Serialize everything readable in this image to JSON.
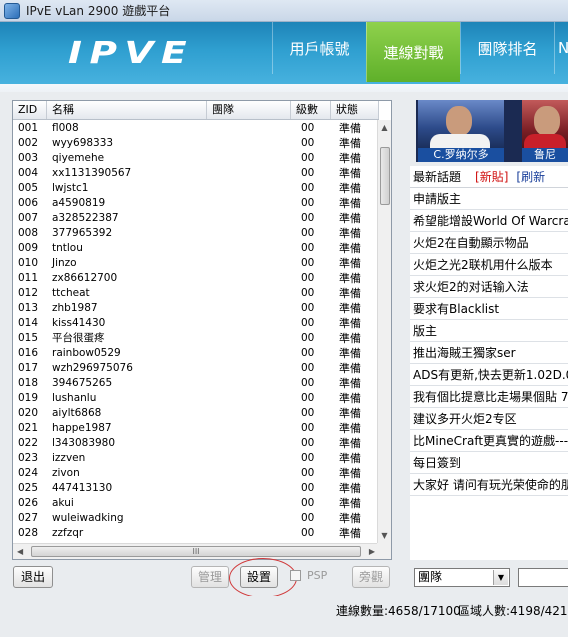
{
  "window": {
    "title": "IPvE vLan 2900 遊戲平台"
  },
  "header": {
    "logo_text": "IPVE",
    "nav_tabs": [
      {
        "label": "用戶帳號",
        "active": false
      },
      {
        "label": "連線對戰",
        "active": true
      },
      {
        "label": "團隊排名",
        "active": false
      },
      {
        "label": "N",
        "active": false
      }
    ]
  },
  "player_list": {
    "columns": [
      "ZID",
      "名稱",
      "團隊",
      "級數",
      "狀態"
    ],
    "rows": [
      {
        "zid": "001",
        "name": "fl008",
        "team": "",
        "level": "00",
        "status": "準備"
      },
      {
        "zid": "002",
        "name": "wyy698333",
        "team": "",
        "level": "00",
        "status": "準備"
      },
      {
        "zid": "003",
        "name": "qiyemehe",
        "team": "",
        "level": "00",
        "status": "準備"
      },
      {
        "zid": "004",
        "name": "xx1131390567",
        "team": "",
        "level": "00",
        "status": "準備"
      },
      {
        "zid": "005",
        "name": "lwjstc1",
        "team": "",
        "level": "00",
        "status": "準備"
      },
      {
        "zid": "006",
        "name": "a4590819",
        "team": "",
        "level": "00",
        "status": "準備"
      },
      {
        "zid": "007",
        "name": "a328522387",
        "team": "",
        "level": "00",
        "status": "準備"
      },
      {
        "zid": "008",
        "name": "377965392",
        "team": "",
        "level": "00",
        "status": "準備"
      },
      {
        "zid": "009",
        "name": "tntlou",
        "team": "",
        "level": "00",
        "status": "準備"
      },
      {
        "zid": "010",
        "name": "Jinzo",
        "team": "",
        "level": "00",
        "status": "準備"
      },
      {
        "zid": "011",
        "name": "zx86612700",
        "team": "",
        "level": "00",
        "status": "準備"
      },
      {
        "zid": "012",
        "name": "ttcheat",
        "team": "",
        "level": "00",
        "status": "準備"
      },
      {
        "zid": "013",
        "name": "zhb1987",
        "team": "",
        "level": "00",
        "status": "準備"
      },
      {
        "zid": "014",
        "name": "kiss41430",
        "team": "",
        "level": "00",
        "status": "準備"
      },
      {
        "zid": "015",
        "name": "平台很蛋疼",
        "team": "",
        "level": "00",
        "status": "準備"
      },
      {
        "zid": "016",
        "name": "rainbow0529",
        "team": "",
        "level": "00",
        "status": "準備"
      },
      {
        "zid": "017",
        "name": "wzh296975076",
        "team": "",
        "level": "00",
        "status": "準備"
      },
      {
        "zid": "018",
        "name": "394675265",
        "team": "",
        "level": "00",
        "status": "準備"
      },
      {
        "zid": "019",
        "name": "lushanlu",
        "team": "",
        "level": "00",
        "status": "準備"
      },
      {
        "zid": "020",
        "name": "aiylt6868",
        "team": "",
        "level": "00",
        "status": "準備"
      },
      {
        "zid": "021",
        "name": "happe1987",
        "team": "",
        "level": "00",
        "status": "準備"
      },
      {
        "zid": "022",
        "name": "l343083980",
        "team": "",
        "level": "00",
        "status": "準備"
      },
      {
        "zid": "023",
        "name": "izzven",
        "team": "",
        "level": "00",
        "status": "準備"
      },
      {
        "zid": "024",
        "name": "zivon",
        "team": "",
        "level": "00",
        "status": "準備"
      },
      {
        "zid": "025",
        "name": "447413130",
        "team": "",
        "level": "00",
        "status": "準備"
      },
      {
        "zid": "026",
        "name": "akui",
        "team": "",
        "level": "00",
        "status": "準備"
      },
      {
        "zid": "027",
        "name": "wuleiwadking",
        "team": "",
        "level": "00",
        "status": "準備"
      },
      {
        "zid": "028",
        "name": "zzfzqr",
        "team": "",
        "level": "00",
        "status": "準備"
      }
    ],
    "hscroll_grip": "III"
  },
  "buttons": {
    "exit": "退出",
    "manage": "管理",
    "settings": "設置",
    "psp": "PSP",
    "spectate": "旁觀"
  },
  "right_panel": {
    "photos": [
      {
        "caption": "C.罗纳尔多"
      },
      {
        "caption": "鲁尼"
      }
    ],
    "forum": {
      "latest_label": "最新話題",
      "new_post": "[新貼]",
      "refresh": "[刷新",
      "topics": [
        "申請版主",
        "希望能增設World Of Warcraft",
        "火炬2在自動顯示物品",
        "火炬之光2联机用什么版本",
        "求火炬2的对话输入法",
        "要求有Blacklist",
        "版主",
        "推出海賊王獨家ser",
        "ADS有更新,快去更新1.02D.0",
        "我有個比提意比走場果個貼 7",
        "建议多开火炬2专区",
        "比MineCraft更真實的遊戲---B",
        "每日簽到",
        "大家好 请问有玩光荣使命的朋"
      ]
    },
    "team_select": "團隊"
  },
  "status": {
    "online": "連線數量:4658/17100",
    "area": "區域人數:4198/4218"
  },
  "colors": {
    "header_blue": "#2f9fd0",
    "active_tab_green": "#6fbf35",
    "annotation_circle": "#d0393a",
    "new_post_red": "#d01010"
  }
}
